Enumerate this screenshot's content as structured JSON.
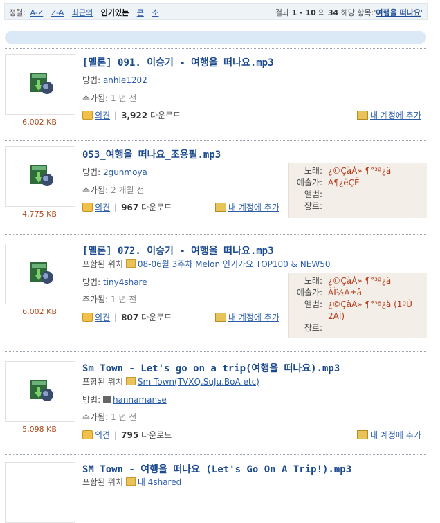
{
  "sort": {
    "label": "정렬:",
    "options": [
      {
        "label": "A-Z",
        "active": false
      },
      {
        "label": "Z-A",
        "active": false
      },
      {
        "label": "최근의",
        "active": false
      },
      {
        "label": "인기있는",
        "active": true
      },
      {
        "label": "큰",
        "active": false
      },
      {
        "label": "소",
        "active": false
      }
    ]
  },
  "results": {
    "prefix": "결과",
    "range": "1 - 10",
    "of": "의",
    "total": "34",
    "suffix": "해당 항목:",
    "query": "여행을 떠나요",
    "quote_open": "'",
    "quote_close": "'"
  },
  "labels": {
    "method": "방법:",
    "added": "추가됨:",
    "included": "포함된 위치",
    "opinion": "의견",
    "downloads": "다운로드",
    "add_account": "내 계정에 추가",
    "meta_song": "노래:",
    "meta_artist": "예술가:",
    "meta_album": "앨범:",
    "meta_genre": "장르:"
  },
  "items": [
    {
      "title": "[멜론] 091. 이승기 - 여행을 떠나요.mp3",
      "user": "anhle1202",
      "added": "1 년 전",
      "downloads": "3,922",
      "size": "6,002 KB"
    },
    {
      "title": "053_여행을 떠나요_조용필.mp3",
      "user": "2gunmoya",
      "added": "2 개월 전",
      "downloads": "967",
      "size": "4,775 KB",
      "meta": {
        "song": "¿©ÇàÀ» ¶°³ª¿ä",
        "artist": "Á¶¿ëÇÊ",
        "album": "",
        "genre": ""
      }
    },
    {
      "title": "[멜론] 072. 이승기 - 여행을 떠나요.mp3",
      "folder": "08-06월 3주차 Melon 인기가요 TOP100 & NEW50",
      "user": "tiny4share",
      "added": "1 년 전",
      "downloads": "807",
      "size": "6,002 KB",
      "meta": {
        "song": "¿©ÇàÀ» ¶°³ª¿ä",
        "artist": "ÀÌ½Â±â",
        "album": "¿©ÇàÀ» ¶°³ª¿ä (1ºÚ 2ÀÌ)",
        "genre": ""
      }
    },
    {
      "title": "Sm Town - Let's go on a trip(여행을 떠나요).mp3",
      "folder": "Sm Town(TVXQ,SuJu,BoA etc)",
      "user": "hannamanse",
      "added": "1 년 전",
      "downloads": "795",
      "size": "5,098 KB"
    },
    {
      "title": "SM Town - 여행을 떠나요 (Let's Go On A Trip!).mp3",
      "folder": "내 4shared"
    }
  ]
}
